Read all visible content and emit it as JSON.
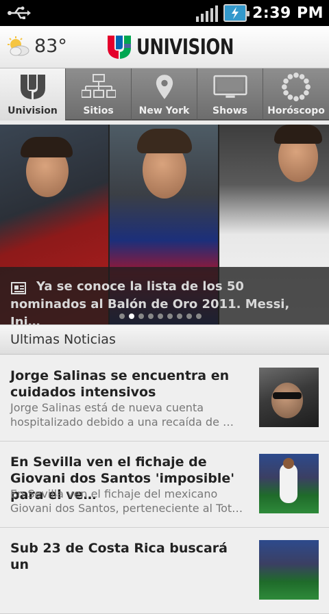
{
  "status_bar": {
    "time": "2:39 PM",
    "icons": [
      "usb-icon",
      "signal-icon",
      "battery-charging-icon"
    ]
  },
  "header": {
    "weather_icon": "partly-cloudy-icon",
    "temperature": "83°",
    "logo_text": "UNIVISION"
  },
  "tabs": [
    {
      "label": "Univision",
      "icon": "univision-logo-icon",
      "active": true
    },
    {
      "label": "Sitios",
      "icon": "sitemap-icon",
      "active": false
    },
    {
      "label": "New York",
      "icon": "location-pin-icon",
      "active": false
    },
    {
      "label": "Shows",
      "icon": "tv-icon",
      "active": false
    },
    {
      "label": "Horóscopo",
      "icon": "zodiac-ring-icon",
      "active": false
    }
  ],
  "carousel": {
    "caption": "Ya se conoce la lista de los 50 nominados al Balón de Oro 2011. Messi, Ini…",
    "caption_icon": "article-icon",
    "dot_count": 9,
    "active_dot": 1
  },
  "section": {
    "title": "Ultimas Noticias"
  },
  "news": [
    {
      "title": "Jorge Salinas se encuentra en cuidados intensivos",
      "summary": "Jorge Salinas está de nueva cuenta hospitalizado debido a una recaída de …"
    },
    {
      "title": "En Sevilla ven el fichaje de Giovani dos Santos 'imposible' para el ve…",
      "summary": "En Sevilla ven el fichaje del mexicano Giovani dos Santos, perteneciente al Tot…"
    },
    {
      "title": "Sub 23 de Costa Rica buscará un",
      "summary": ""
    }
  ],
  "colors": {
    "tab_bar": "#7a7a7a",
    "tab_active": "#e8e8e8",
    "logo_red": "#e4002b",
    "logo_blue": "#0066b3",
    "logo_green": "#00a651"
  }
}
